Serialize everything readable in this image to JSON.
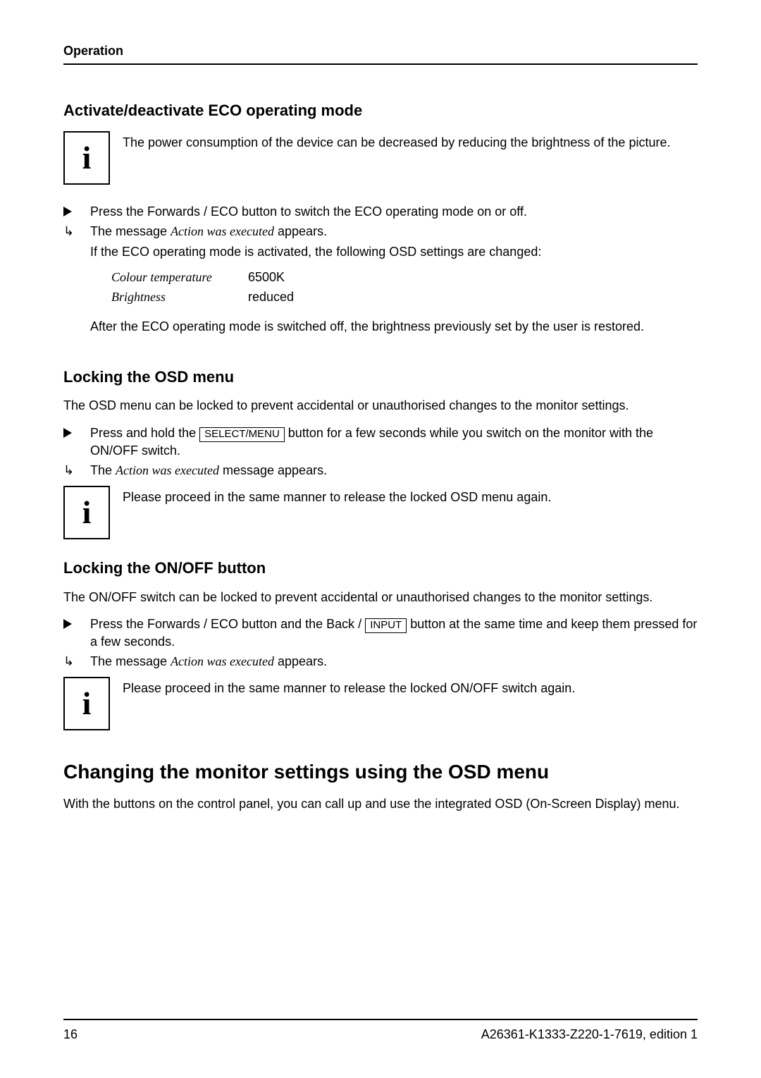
{
  "header": {
    "section": "Operation"
  },
  "s1": {
    "heading": "Activate/deactivate ECO operating mode",
    "info_text": "The power consumption of the device can be decreased by reducing the brightness of the picture.",
    "step1": "Press the Forwards / ECO button to switch the ECO operating mode on or off.",
    "result_pre": "The message ",
    "result_em": "Action was executed",
    "result_post": " appears.",
    "cond": "If the ECO operating mode is activated, the following OSD settings are changed:",
    "table": {
      "r1_label": "Colour temperature",
      "r1_value": "6500K",
      "r2_label": "Brightness",
      "r2_value": "reduced"
    },
    "after": "After the ECO operating mode is switched off, the brightness previously set by the user is restored."
  },
  "s2": {
    "heading": "Locking the OSD menu",
    "intro": "The OSD menu can be locked to prevent accidental or unauthorised changes to the monitor settings.",
    "step1_pre": "Press and hold the ",
    "step1_key": "SELECT/MENU",
    "step1_post": " button for a few seconds while you switch on the monitor with the ON/OFF switch.",
    "result_pre": "The ",
    "result_em": "Action was executed",
    "result_post": " message appears.",
    "info_text": "Please proceed in the same manner to release the locked OSD menu again."
  },
  "s3": {
    "heading": "Locking the ON/OFF button",
    "intro": "The ON/OFF switch can be locked to prevent accidental or unauthorised changes to the monitor settings.",
    "step1_pre": "Press the Forwards / ECO button and the Back / ",
    "step1_key": "INPUT",
    "step1_post": " button at the same time and keep them pressed for a few seconds.",
    "result_pre": "The message ",
    "result_em": "Action was executed",
    "result_post": " appears.",
    "info_text": "Please proceed in the same manner to release the locked ON/OFF switch again."
  },
  "s4": {
    "heading": "Changing the monitor settings using the OSD menu",
    "para": "With the buttons on the control panel, you can call up and use the integrated OSD (On-Screen Display) menu."
  },
  "footer": {
    "page_number": "16",
    "doc_id": "A26361-K1333-Z220-1-7619, edition 1"
  },
  "icons": {
    "info_glyph": "i"
  }
}
